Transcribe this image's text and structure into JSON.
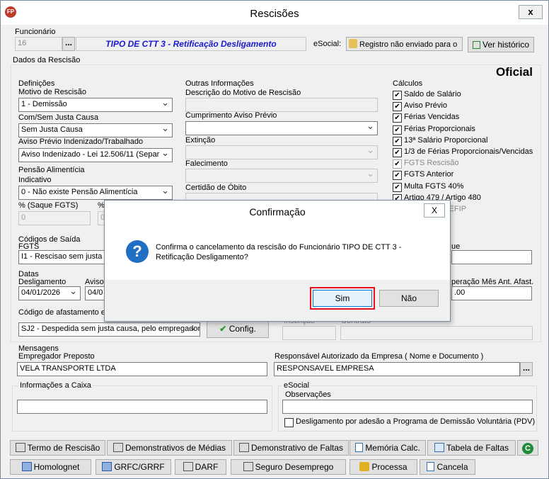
{
  "window": {
    "title": "Rescisões",
    "close": "x",
    "app_icon": "FP"
  },
  "funcionario": {
    "label": "Funcionário",
    "code": "16",
    "ellipsis": "...",
    "name": "TIPO DE CTT 3 - Retificação Desligamento",
    "esocial_label": "eSocial:",
    "esocial_status": "Registro não enviado para o",
    "history_button": "Ver histórico"
  },
  "dados_label": "Dados da Rescisão",
  "oficial": "Oficial",
  "definicoes": {
    "title": "Definições",
    "motivo_label": "Motivo de Rescisão",
    "motivo_value": "1 - Demissão",
    "justa_label": "Com/Sem Justa Causa",
    "justa_value": "Sem Justa Causa",
    "aviso_label": "Aviso Prévio Indenizado/Trabalhado",
    "aviso_value": "Aviso Indenizado - Lei 12.506/11 (Separ"
  },
  "pensao": {
    "title": "Pensão Alimentícia",
    "indicativo_label": "Indicativo",
    "indicativo_value": "0 - Não existe Pensão Alimentícia",
    "saque_label": "% (Saque FGTS)",
    "saque_value": "0",
    "pct2_label": "%",
    "pct2_value": "0"
  },
  "outras": {
    "title": "Outras Informações",
    "desc_label": "Descrição do Motivo de Rescisão",
    "cumprimento_label": "Cumprimento Aviso Prévio",
    "extincao_label": "Extinção",
    "falecimento_label": "Falecimento",
    "certidao_label": "Certidão de Óbito"
  },
  "calculos": {
    "title": "Cálculos",
    "items": [
      {
        "label": "Saldo de Salário",
        "checked": true
      },
      {
        "label": "Aviso Prévio",
        "checked": true
      },
      {
        "label": "Férias Vencidas",
        "checked": true
      },
      {
        "label": "Férias Proporcionais",
        "checked": true
      },
      {
        "label": "13ª Salário Proporcional",
        "checked": true
      },
      {
        "label": "1/3 de Férias Proporcionais/Vencidas",
        "checked": true
      },
      {
        "label": "FGTS Rescisão",
        "checked": true,
        "disabled": true
      },
      {
        "label": "FGTS Anterior",
        "checked": true
      },
      {
        "label": "Multa FGTS 40%",
        "checked": true
      },
      {
        "label": "Artigo 479 / Artigo 480",
        "checked": true
      },
      {
        "label": "C antes da SEFIP",
        "checked": false,
        "disabled": true
      }
    ]
  },
  "codigos": {
    "title": "Códigos de Saída",
    "fgts_label": "FGTS",
    "fgts_value": "I1 - Rescisao sem justa ca",
    "right_label": "ue"
  },
  "datas": {
    "title": "Datas",
    "deslig_label": "Desligamento",
    "deslig_value": "04/01/2026",
    "aviso_label": "Aviso",
    "aviso_value": "04/0",
    "operacao_label": "peração Mês Ant. Afast.",
    "operacao_value": ".00"
  },
  "afastamento": {
    "label": "Código de afastamento e",
    "value": "SJ2 - Despedida sem justa causa, pelo empregador",
    "config_button": "Config.",
    "insc_label": "Inscrição",
    "contrato_label": "Contrato"
  },
  "mensagens": {
    "title": "Mensagens",
    "empregador_label": "Empregador Preposto",
    "empregador_value": "VELA TRANSPORTE LTDA",
    "responsavel_label": "Responsável Autorizado da Empresa ( Nome e Documento )",
    "responsavel_value": "RESPONSAVEL EMPRESA",
    "ellipsis": "..."
  },
  "informacoes": {
    "title": "Informações a Caixa"
  },
  "esocial": {
    "title": "eSocial",
    "obs_label": "Observações",
    "pdv_label": "Desligamento por adesão a Programa de Demissão Voluntária (PDV)"
  },
  "toolbar1": [
    "Termo de Rescisão",
    "Demonstrativos de Médias",
    "Demonstrativo de Faltas",
    "Memória Calc.",
    "Tabela de Faltas"
  ],
  "toolbar2": [
    "Homolognet",
    "GRFC/GRRF",
    "DARF",
    "Seguro Desemprego",
    "Processa",
    "Cancela"
  ],
  "dialog": {
    "title": "Confirmação",
    "close": "X",
    "message": "Confirma o cancelamento da rescisão do Funcionário TIPO DE CTT 3 - Retificação Desligamento?",
    "icon": "?",
    "yes": "Sim",
    "no": "Não"
  },
  "colors": {
    "name_text": "#1a1ad0",
    "highlight": "#e81123",
    "question": "#1f6fc5"
  }
}
